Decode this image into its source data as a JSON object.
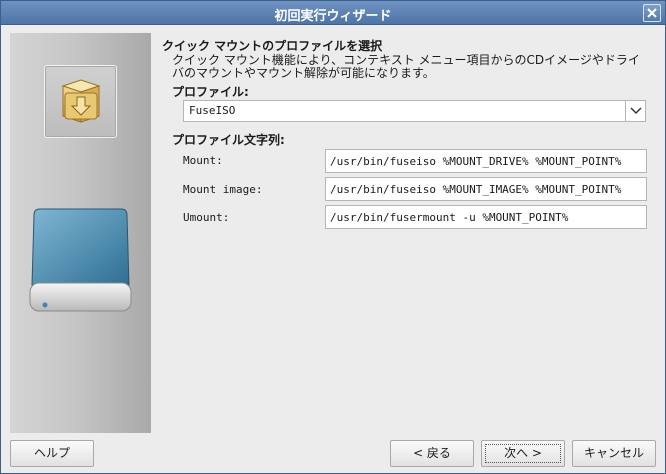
{
  "window": {
    "title": "初回実行ウィザード"
  },
  "sidebar": {
    "top_icon": "package-download-icon",
    "bottom_icon": "removable-drive-icon"
  },
  "main": {
    "heading": "クイック マウントのプロファイルを選択",
    "description": "クイック マウント機能により、コンテキスト メニュー項目からのCDイメージやドライバのマウントやマウント解除が可能になります。",
    "profile_label": "プロファイル:",
    "profile_value": "FuseISO",
    "strings_label": "プロファイル文字列:",
    "rows": [
      {
        "label": "Mount:",
        "value": "/usr/bin/fuseiso %MOUNT_DRIVE% %MOUNT_POINT%"
      },
      {
        "label": "Mount image:",
        "value": "/usr/bin/fuseiso %MOUNT_IMAGE% %MOUNT_POINT%"
      },
      {
        "label": "Umount:",
        "value": "/usr/bin/fusermount -u %MOUNT_POINT%"
      }
    ]
  },
  "buttons": {
    "help": "ヘルプ",
    "back": "< 戻る",
    "next": "次へ >",
    "cancel": "キャンセル"
  },
  "colors": {
    "titlebar": "#4e74a8",
    "accent": "#3e5f8c"
  }
}
